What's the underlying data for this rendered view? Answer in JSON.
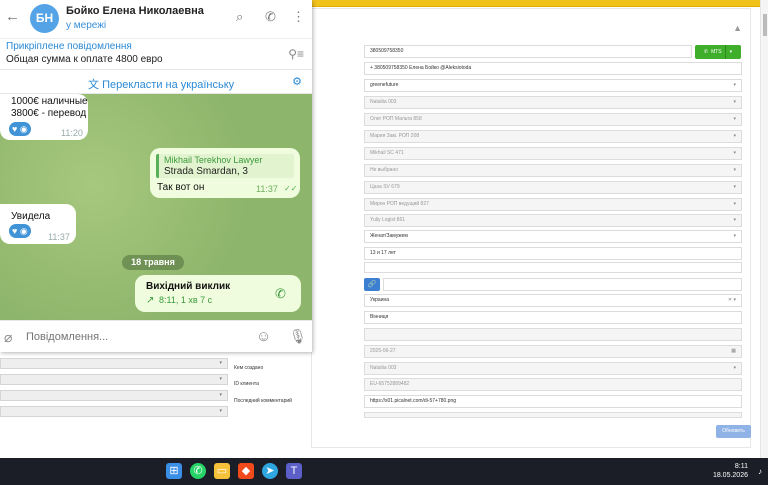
{
  "telegram": {
    "contact_initials": "БН",
    "contact_name": "Бойко Елена Николаевна",
    "contact_status": "у мережі",
    "pinned_title": "Прикріплене повідомлення",
    "pinned_text": "Общая сумма к оплате 4800 евро",
    "translate_label": "Перекласти на українську",
    "messages": [
      {
        "direction": "in",
        "lines": [
          "1000€ наличные",
          "3800€ - перевод"
        ],
        "time": "11:20"
      },
      {
        "direction": "out",
        "reply_author": "Mikhail Terekhov Lawyer",
        "reply_text": "Strada Smardan, 3",
        "text": "Так вот он",
        "time": "11:37"
      },
      {
        "direction": "in",
        "text": "Увидела",
        "time": "11:37"
      }
    ],
    "date_separator": "18 травня",
    "call": {
      "title": "Вихідний виклик",
      "detail": "8:11, 1 хв 7 с"
    },
    "input_placeholder": "Повідомлення..."
  },
  "crm": {
    "phone": "380509758350",
    "call_button": "MTS",
    "contact_line": "+ 380509758350 Елена Бойко @Aleksiotoda",
    "fields": [
      "greenefuture",
      "Nataliia 003",
      "Олег РОП Мальта 858",
      "Мария Зам. РОП 208",
      "Mikhail SC 471",
      "Не выбрано",
      "Цаха SV 679",
      "Мирон РОП ведущий 827",
      "Yuliy Logist 861",
      "Женат/Замужем",
      "13 и 17 лет",
      "",
      "Украина",
      "Вінниця",
      "",
      "2025-06-27",
      "Nataliia 003",
      "EU-65752889482",
      "https://s01.picalnet.com/di-57+780.png"
    ],
    "labels": [
      "Кем создано",
      "ID клиента",
      "Последний комментарий"
    ],
    "save_button": "Обновить"
  },
  "taskbar": {
    "time": "8:11",
    "date": "18.05.2026"
  },
  "colors": {
    "telegram_blue": "#2b8ad5",
    "crm_yellow": "#f1c21b",
    "mts_green": "#3fae2a",
    "chat_bg": "#8fb86e"
  }
}
